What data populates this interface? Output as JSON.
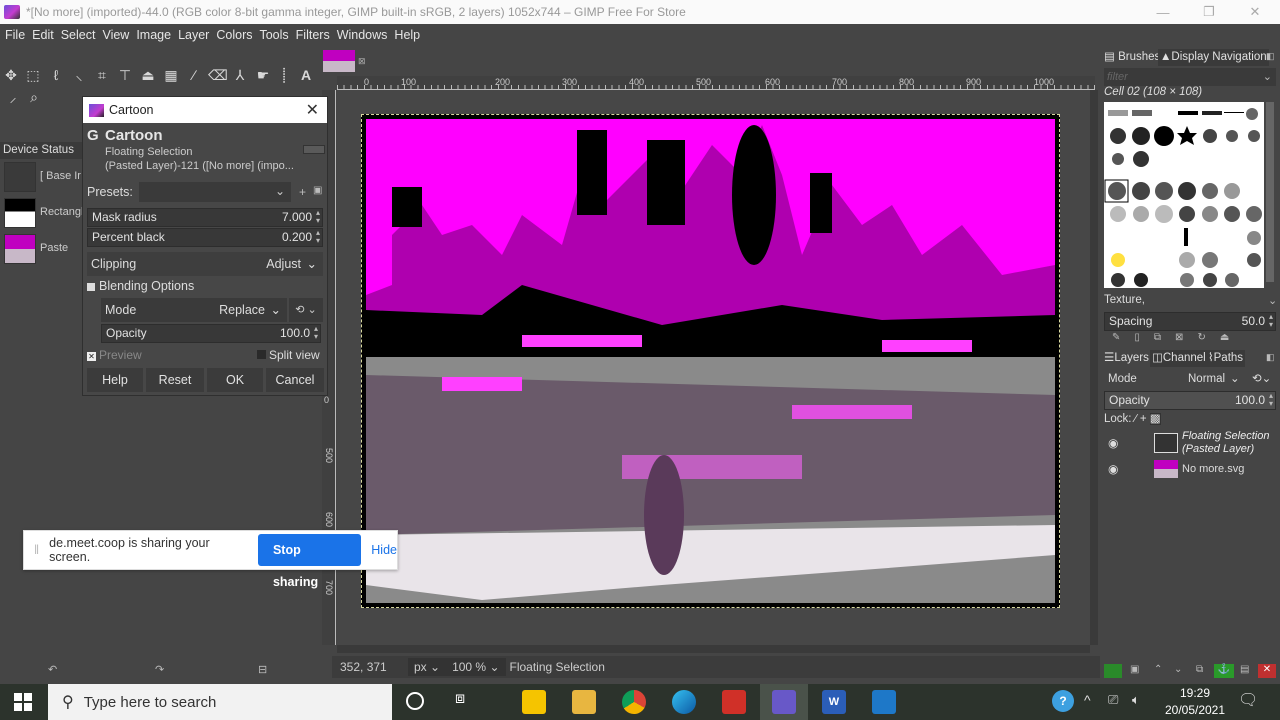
{
  "window": {
    "title": "*[No more] (imported)-44.0 (RGB color 8-bit gamma integer, GIMP built-in sRGB, 2 layers) 1052x744 – GIMP Free For Store",
    "controls": {
      "minimize": "—",
      "maximize": "❐",
      "close": "✕"
    }
  },
  "menu": [
    "File",
    "Edit",
    "Select",
    "View",
    "Image",
    "Layer",
    "Colors",
    "Tools",
    "Filters",
    "Windows",
    "Help"
  ],
  "toolbox": {
    "tools": [
      "move-tool",
      "rect-select-tool",
      "free-select-tool",
      "fuzzy-select-tool",
      "crop-tool",
      "unified-transform-tool",
      "warp-tool",
      "gradient-tool",
      "paintbrush-tool",
      "eraser-tool",
      "clone-tool",
      "smudge-tool",
      "path-tool",
      "text-tool",
      "color-picker-tool",
      "zoom-tool"
    ],
    "glyphs": [
      "✥",
      "⬚",
      "ℓ",
      "⸜",
      "⌗",
      "⊤",
      "⏏",
      "▦",
      "∕",
      "⌫",
      "⅄",
      "☛",
      "⸽",
      "A",
      "⸝",
      "⌕"
    ]
  },
  "device_status": {
    "tab_label": "Device Status",
    "rows": [
      {
        "label": "[ Base Ir"
      },
      {
        "label": "Rectangl"
      },
      {
        "label": "Paste"
      }
    ]
  },
  "dialog": {
    "window_title": "Cartoon",
    "heading": "Cartoon",
    "subtitle1": "Floating Selection",
    "subtitle2": "(Pasted Layer)-121 ([No more] (impo...",
    "presets_label": "Presets:",
    "presets_value": "",
    "mask_radius": {
      "label": "Mask radius",
      "value": "7.000"
    },
    "percent_black": {
      "label": "Percent black",
      "value": "0.200"
    },
    "clipping": {
      "label": "Clipping",
      "value": "Adjust"
    },
    "blending": {
      "label": "Blending Options",
      "mode_label": "Mode",
      "mode_value": "Replace",
      "opacity_label": "Opacity",
      "opacity_value": "100.0"
    },
    "preview_label": "Preview",
    "preview_checked": true,
    "split_view_label": "Split view",
    "split_view_checked": false,
    "buttons": {
      "help": "Help",
      "reset": "Reset",
      "ok": "OK",
      "cancel": "Cancel"
    }
  },
  "rulers": {
    "h_labels": [
      "0",
      "100",
      "200",
      "300",
      "400",
      "500",
      "600",
      "700",
      "800",
      "900",
      "1000"
    ],
    "v_labels": [
      "0",
      "500",
      "600",
      "700"
    ]
  },
  "statusbar": {
    "coords": "352, 371",
    "unit": "px",
    "zoom": "100 %",
    "message": "Floating Selection"
  },
  "brushes": {
    "tabs": [
      "Brushes",
      "Display Navigation"
    ],
    "filter_placeholder": "filter",
    "selected_brush": "Cell 02 (108 × 108)",
    "tag_value": "Texture,",
    "spacing_label": "Spacing",
    "spacing_value": "50.0"
  },
  "layers": {
    "tabs": [
      "Layers",
      "Channels",
      "Paths"
    ],
    "mode_label": "Mode",
    "mode_value": "Normal",
    "opacity_label": "Opacity",
    "opacity_value": "100.0",
    "lock_label": "Lock:",
    "items": [
      {
        "name": "Floating Selection\n(Pasted Layer)",
        "line1": "Floating Selection",
        "line2": "(Pasted Layer)",
        "visible": true
      },
      {
        "name": "No more.svg",
        "visible": true
      }
    ]
  },
  "screen_share": {
    "message": "de.meet.coop is sharing your screen.",
    "stop_label": "Stop sharing",
    "hide_label": "Hide"
  },
  "taskbar": {
    "search_placeholder": "Type here to search",
    "apps": [
      "sticky-notes",
      "file-explorer",
      "chrome",
      "edge",
      "app-red",
      "gimp",
      "word",
      "photos"
    ],
    "time": "19:29",
    "date": "20/05/2021"
  },
  "colors": {
    "accent_magenta": "#ff00ff",
    "share_button": "#1a73e8",
    "gimp_bg": "#454545"
  }
}
